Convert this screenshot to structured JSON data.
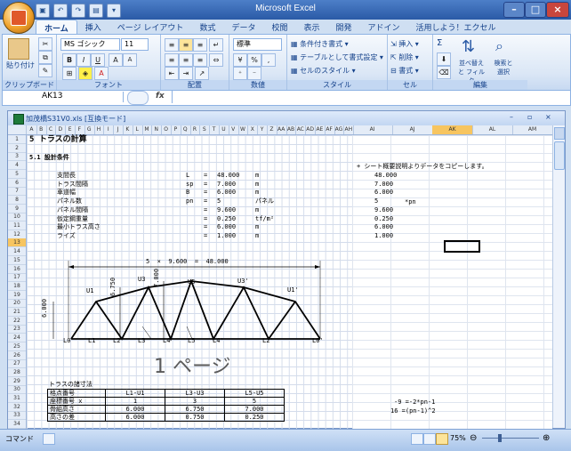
{
  "window": {
    "title": "Microsoft Excel"
  },
  "tabs": [
    "ホーム",
    "挿入",
    "ページ レイアウト",
    "数式",
    "データ",
    "校閲",
    "表示",
    "開発",
    "アドイン",
    "活用しよう！エクセル"
  ],
  "ribbon": {
    "clipboard": {
      "paste": "貼り付け",
      "label": "クリップボード"
    },
    "font": {
      "name": "MS ゴシック",
      "size": "11",
      "label": "フォント",
      "bold": "B",
      "italic": "I",
      "underline": "U",
      "grow": "A",
      "shrink": "A"
    },
    "alignment": {
      "label": "配置"
    },
    "number": {
      "format": "標準",
      "label": "数値",
      "percent": "%"
    },
    "styles": {
      "conditional": "条件付き書式",
      "table": "テーブルとして書式設定",
      "cell": "セルのスタイル",
      "label": "スタイル"
    },
    "cells": {
      "insert": "挿入",
      "delete": "削除",
      "format": "書式",
      "label": "セル"
    },
    "editing": {
      "sigma": "Σ",
      "sort": "並べ替えと フィルタ",
      "find": "検索と 選択",
      "label": "編集"
    }
  },
  "formula_bar": {
    "name_box": "AK13",
    "fx": "fx",
    "value": ""
  },
  "workbook": {
    "title": "加茂橋S31V0.xls [互換モード]"
  },
  "columns": [
    "A",
    "B",
    "C",
    "D",
    "E",
    "F",
    "G",
    "H",
    "I",
    "J",
    "K",
    "L",
    "M",
    "N",
    "O",
    "P",
    "Q",
    "R",
    "S",
    "T",
    "U",
    "V",
    "W",
    "X",
    "Y",
    "Z",
    "AA",
    "AB",
    "AC",
    "AD",
    "AE",
    "AF",
    "AG",
    "AH"
  ],
  "right_columns": [
    "AI",
    "AJ",
    "AK",
    "AL",
    "AM"
  ],
  "rows": [
    "1",
    "2",
    "3",
    "4",
    "5",
    "6",
    "7",
    "8",
    "9",
    "10",
    "11",
    "12",
    "13",
    "14",
    "15",
    "16",
    "17",
    "18",
    "19",
    "20",
    "21",
    "22",
    "23",
    "24",
    "25",
    "26",
    "27",
    "28",
    "29",
    "30",
    "31",
    "32",
    "33",
    "34"
  ],
  "sheet": {
    "r1": "5  トラスの計算",
    "r3": "5.1  設計条件",
    "conditions": [
      {
        "name": "支間長",
        "sym": "L",
        "eq": "=",
        "val": "48.000",
        "unit": "m"
      },
      {
        "name": "トラス間隔",
        "sym": "sp",
        "eq": "=",
        "val": "7.000",
        "unit": "m"
      },
      {
        "name": "車道幅",
        "sym": "B",
        "eq": "=",
        "val": "6.000",
        "unit": "m"
      },
      {
        "name": "パネル数",
        "sym": "pn",
        "eq": "=",
        "val": "5",
        "unit": "パネル"
      },
      {
        "name": "パネル間隔",
        "sym": "",
        "eq": "=",
        "val": "9.600",
        "unit": "m"
      },
      {
        "name": "仮定鋼重量",
        "sym": "",
        "eq": "=",
        "val": "0.250",
        "unit": "tf/m²"
      },
      {
        "name": "最小トラス高さ",
        "sym": "",
        "eq": "=",
        "val": "6.000",
        "unit": "m"
      },
      {
        "name": "ライズ",
        "sym": "",
        "eq": "=",
        "val": "1.000",
        "unit": "m"
      }
    ],
    "span_dim": {
      "n": "5",
      "x": "×",
      "p": "9.600",
      "eq": "=",
      "total": "48.000"
    },
    "upper_nodes": [
      "U1",
      "U3",
      "U5",
      "U3'",
      "U1'"
    ],
    "lower_nodes": [
      "L0",
      "L1",
      "L2",
      "L3",
      "L4",
      "L5",
      "L4'",
      "L2'",
      "L0'"
    ],
    "height_labels": [
      "6.750",
      "7.000",
      "6.000"
    ],
    "page_label": "1 ページ",
    "table_title": "トラスの諸寸法",
    "table": {
      "header": [
        "格点番号",
        "L1-U1",
        "L3-U3",
        "L5-U5"
      ],
      "rows": [
        [
          "座標番号 x",
          "1",
          "3",
          "5"
        ],
        [
          "骨組高さ",
          "6.000",
          "6.750",
          "7.000"
        ],
        [
          "高さの差",
          "6.000",
          "0.750",
          "0.250"
        ]
      ]
    },
    "right_note": "+ シート概要説明よりデータをコピーします。",
    "right_values": [
      "48.000",
      "7.000",
      "6.000",
      "5",
      "9.600",
      "0.250",
      "6.000",
      "1.000"
    ],
    "right_pn": "*pn",
    "formula1": "-9 =-2*pn-1",
    "formula2": "16  =(pn-1)^2"
  },
  "status": {
    "mode": "コマンド",
    "zoom": "75%"
  }
}
